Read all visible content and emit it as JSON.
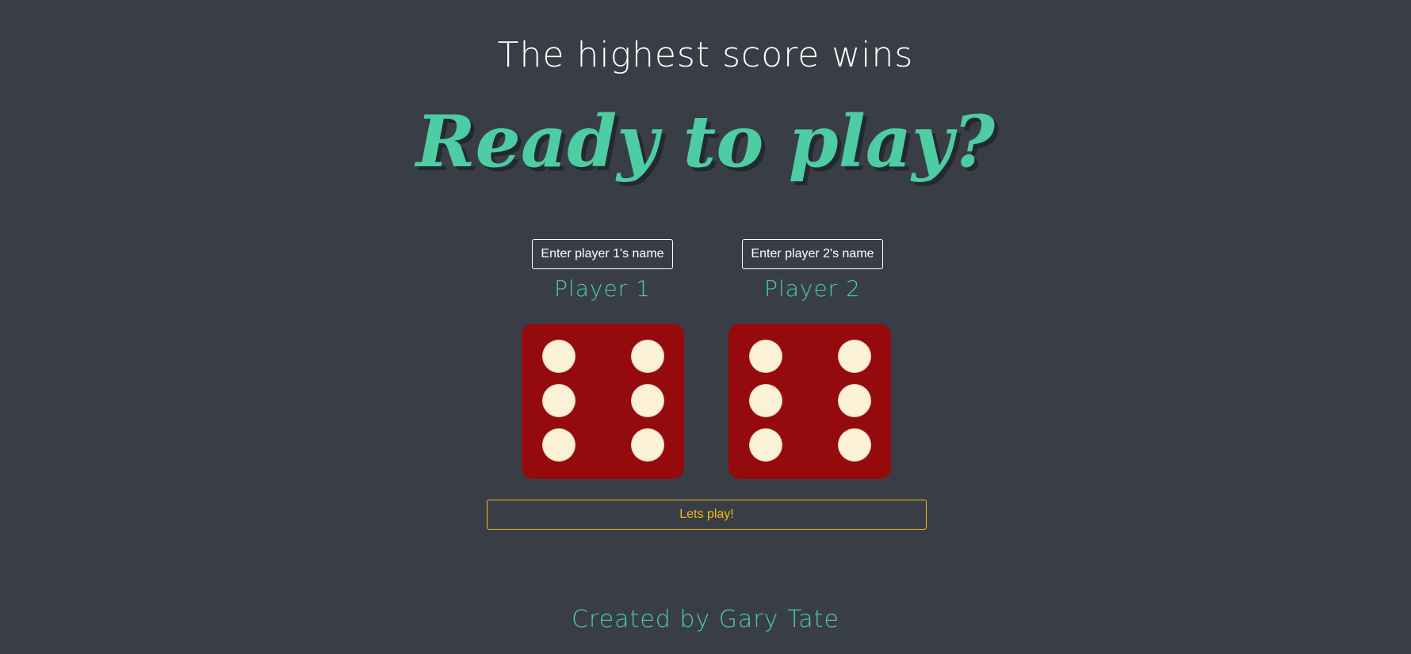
{
  "header": {
    "subtitle": "The highest score wins",
    "title": "Ready to play?"
  },
  "players": [
    {
      "input_placeholder": "Enter player 1's name",
      "label": "Player 1",
      "dice_value": 6
    },
    {
      "input_placeholder": "Enter player 2's name",
      "label": "Player 2",
      "dice_value": 6
    }
  ],
  "play_button": {
    "label": "Lets play!"
  },
  "footer": {
    "credit": "Created by Gary Tate"
  },
  "colors": {
    "background": "#393e46",
    "accent": "#4ecca3",
    "dice_face": "#950a0c",
    "dice_pip": "#fbf1d6",
    "button": "#f5b719"
  }
}
